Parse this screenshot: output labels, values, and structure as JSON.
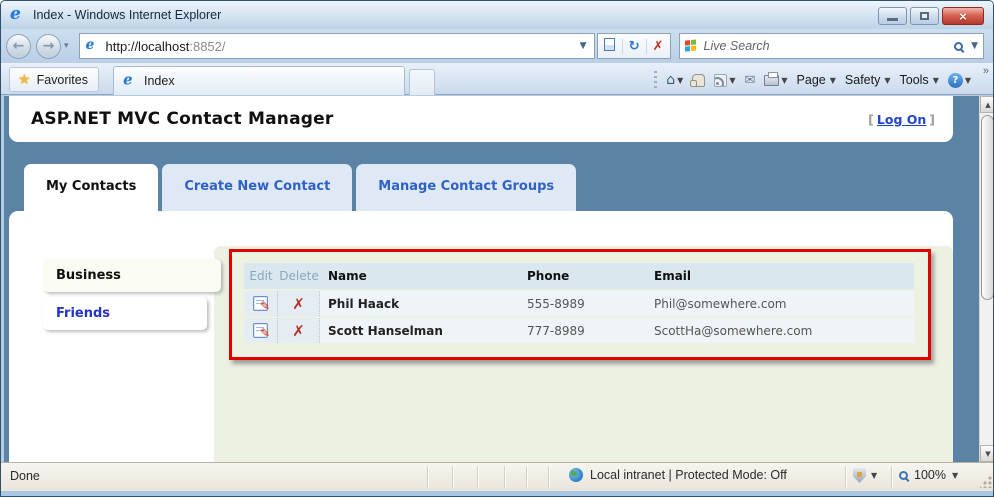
{
  "window": {
    "title": "Index - Windows Internet Explorer"
  },
  "address_bar": {
    "url_host": "http://localhost",
    "url_rest": ":8852/",
    "search_placeholder": "Live Search"
  },
  "favorites_bar": {
    "favorites_label": "Favorites",
    "tab_title": "Index",
    "menu_page": "Page",
    "menu_safety": "Safety",
    "menu_tools": "Tools"
  },
  "page": {
    "header_title": "ASP.NET MVC Contact Manager",
    "logon": {
      "pre": "[",
      "label": "Log On",
      "post": "]"
    },
    "tabs": [
      {
        "label": "My Contacts",
        "active": true
      },
      {
        "label": "Create New Contact",
        "active": false
      },
      {
        "label": "Manage Contact Groups",
        "active": false
      }
    ],
    "groups": [
      {
        "label": "Business",
        "selected": true
      },
      {
        "label": "Friends",
        "selected": false
      }
    ],
    "table": {
      "headers": {
        "edit": "Edit",
        "delete": "Delete",
        "name": "Name",
        "phone": "Phone",
        "email": "Email"
      },
      "rows": [
        {
          "name": "Phil Haack",
          "phone": "555-8989",
          "email": "Phil@somewhere.com"
        },
        {
          "name": "Scott Hanselman",
          "phone": "777-8989",
          "email": "ScottHa@somewhere.com"
        }
      ]
    }
  },
  "status_bar": {
    "status": "Done",
    "zone": "Local intranet | Protected Mode: Off",
    "zoom": "100%"
  },
  "colors": {
    "annotation_red": "#e10000",
    "page_background": "#5b83a6",
    "tab_link_blue": "#2f62c4",
    "green_panel": "#ecf1e2"
  }
}
